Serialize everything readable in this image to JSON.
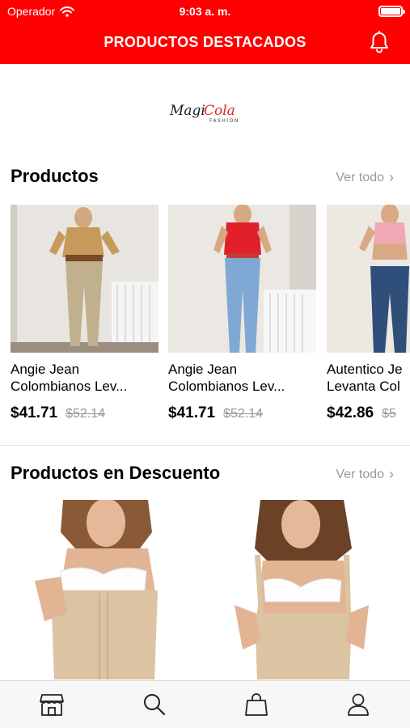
{
  "status_bar": {
    "carrier": "Operador",
    "time": "9:03 a. m."
  },
  "header": {
    "title": "PRODUCTOS DESTACADOS"
  },
  "brand": {
    "part1": "Magi",
    "part2": "Cola",
    "tagline": "FASHION"
  },
  "products_section": {
    "title": "Productos",
    "see_all": "Ver todo",
    "items": [
      {
        "name_line1": "Angie Jean",
        "name_line2": "Colombianos Lev...",
        "price": "$41.71",
        "old_price": "$52.14"
      },
      {
        "name_line1": "Angie Jean",
        "name_line2": "Colombianos Lev...",
        "price": "$41.71",
        "old_price": "$52.14"
      },
      {
        "name_line1": "Autentico Je",
        "name_line2": "Levanta Col",
        "price": "$42.86",
        "old_price": "$5"
      }
    ]
  },
  "discount_section": {
    "title": "Productos en Descuento",
    "see_all": "Ver todo"
  },
  "tabbar": {
    "icons": [
      "store-icon",
      "search-icon",
      "bag-icon",
      "user-icon"
    ]
  },
  "colors": {
    "accent": "#fe0000",
    "muted": "#999999"
  }
}
